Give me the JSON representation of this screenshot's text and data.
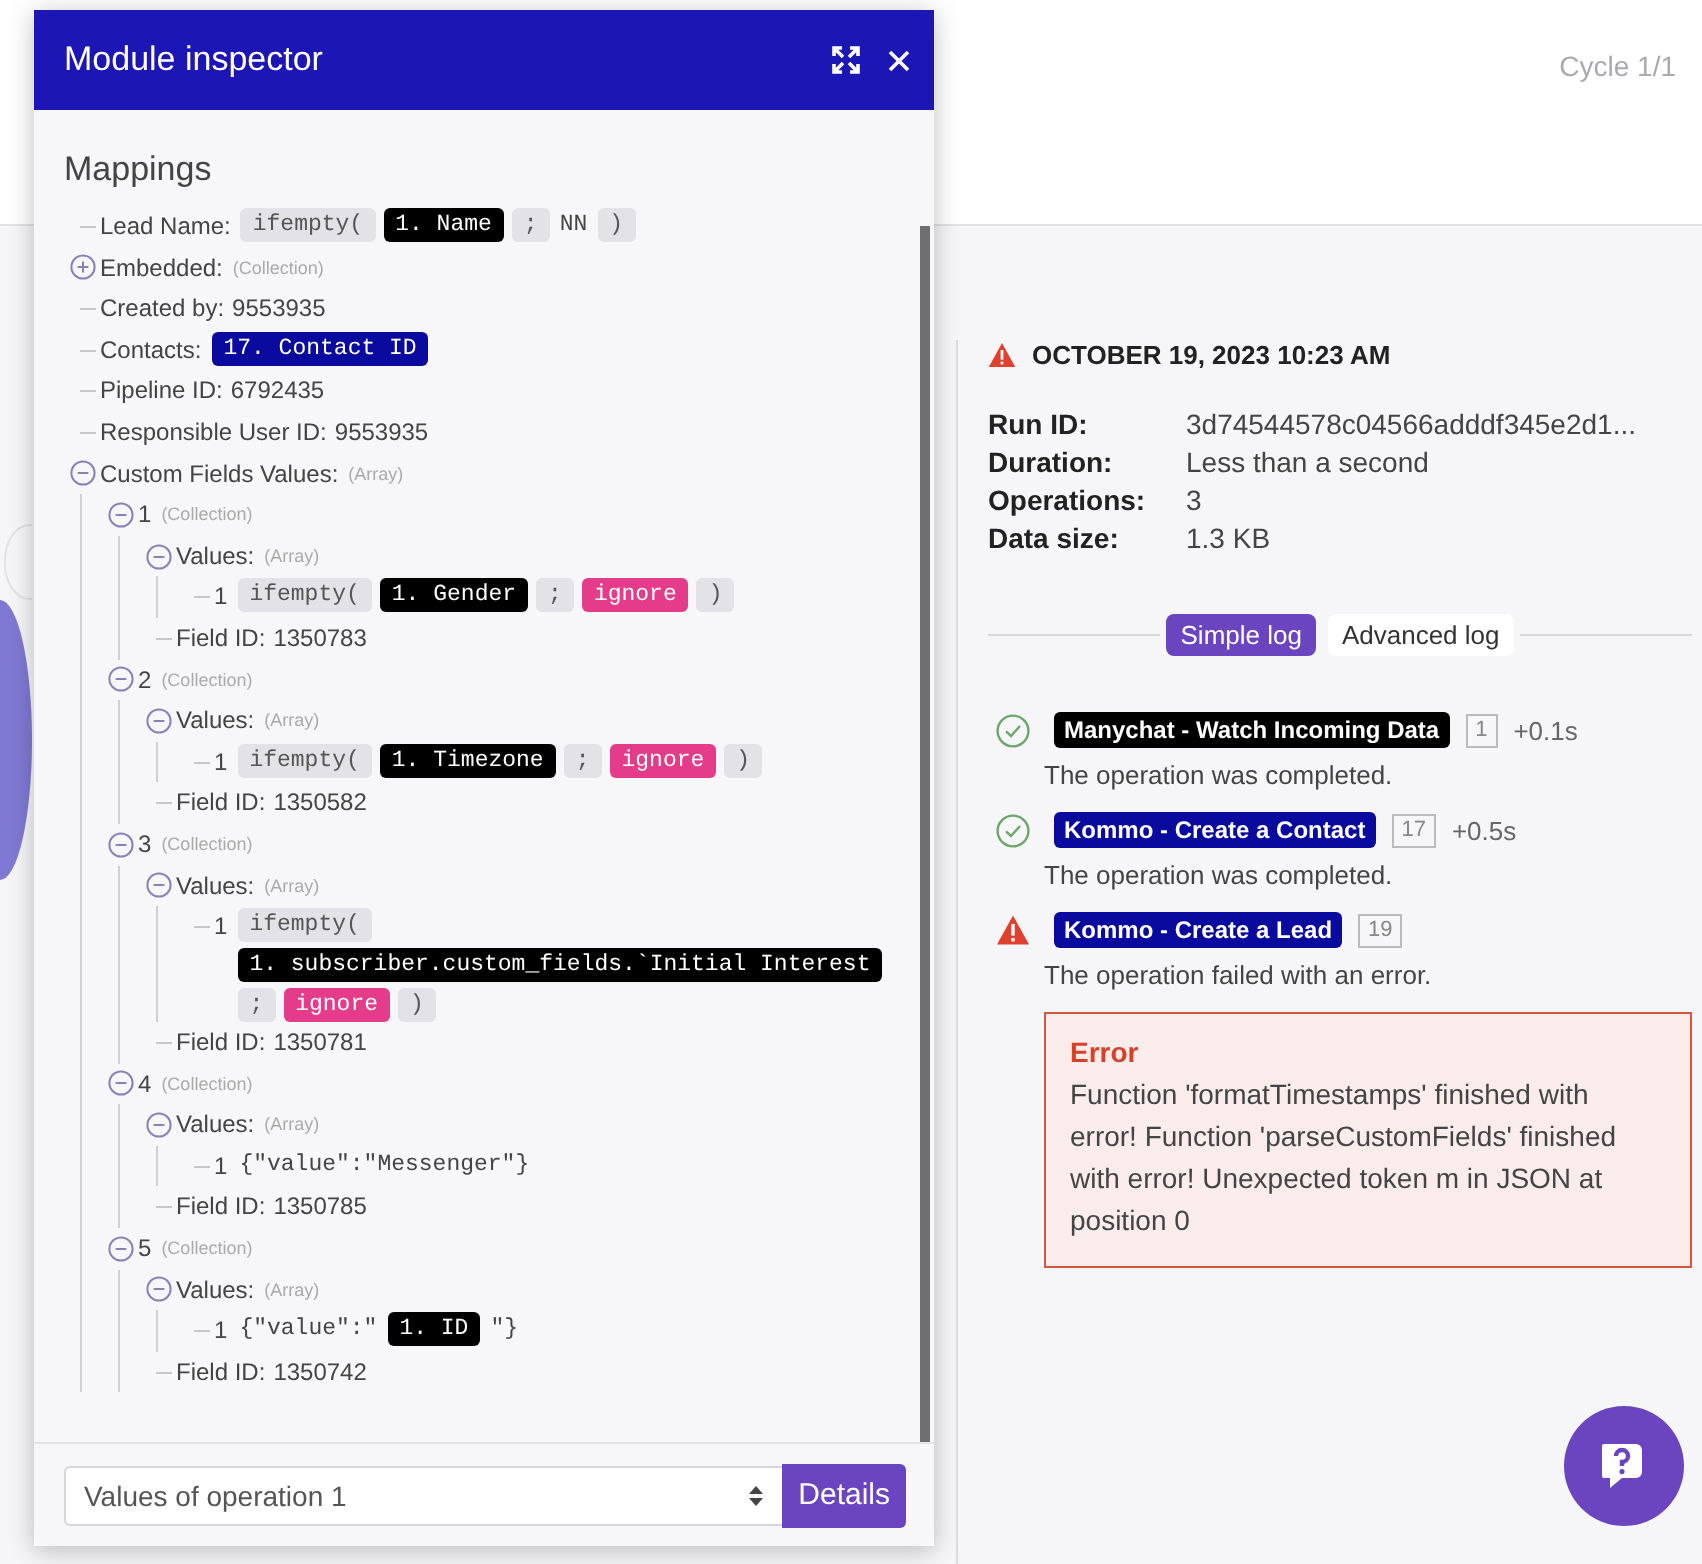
{
  "header": {
    "cycle": "Cycle 1/1"
  },
  "inspector": {
    "title": "Module inspector",
    "section_title": "Mappings",
    "mappings": [
      {
        "label": "Lead Name:",
        "tokens": [
          {
            "kind": "func",
            "text": "ifempty("
          },
          {
            "kind": "var",
            "text": "1. Name"
          },
          {
            "kind": "sep",
            "text": ";"
          },
          {
            "kind": "text",
            "text": "NN"
          },
          {
            "kind": "sep",
            "text": ")"
          }
        ]
      },
      {
        "label": "Embedded:",
        "type": "(Collection)",
        "expanded": false
      },
      {
        "label": "Created by:",
        "value": "9553935"
      },
      {
        "label": "Contacts:",
        "tokens": [
          {
            "kind": "ref",
            "text": "17. Contact ID"
          }
        ]
      },
      {
        "label": "Pipeline ID:",
        "value": "6792435"
      },
      {
        "label": "Responsible User ID:",
        "value": "9553935"
      },
      {
        "label": "Custom Fields Values:",
        "type": "(Array)",
        "expanded": true,
        "children": [
          {
            "label": "1",
            "type": "(Collection)",
            "expanded": true,
            "children": [
              {
                "label": "Values:",
                "type": "(Array)",
                "expanded": true,
                "children": [
                  {
                    "label": "1",
                    "tokens": [
                      {
                        "kind": "func",
                        "text": "ifempty("
                      },
                      {
                        "kind": "var",
                        "text": "1. Gender"
                      },
                      {
                        "kind": "sep",
                        "text": ";"
                      },
                      {
                        "kind": "keyword",
                        "text": "ignore"
                      },
                      {
                        "kind": "sep",
                        "text": ")"
                      }
                    ]
                  }
                ]
              },
              {
                "label": "Field ID:",
                "value": "1350783"
              }
            ]
          },
          {
            "label": "2",
            "type": "(Collection)",
            "expanded": true,
            "children": [
              {
                "label": "Values:",
                "type": "(Array)",
                "expanded": true,
                "children": [
                  {
                    "label": "1",
                    "tokens": [
                      {
                        "kind": "func",
                        "text": "ifempty("
                      },
                      {
                        "kind": "var",
                        "text": "1. Timezone"
                      },
                      {
                        "kind": "sep",
                        "text": ";"
                      },
                      {
                        "kind": "keyword",
                        "text": "ignore"
                      },
                      {
                        "kind": "sep",
                        "text": ")"
                      }
                    ]
                  }
                ]
              },
              {
                "label": "Field ID:",
                "value": "1350582"
              }
            ]
          },
          {
            "label": "3",
            "type": "(Collection)",
            "expanded": true,
            "children": [
              {
                "label": "Values:",
                "type": "(Array)",
                "expanded": true,
                "children": [
                  {
                    "label": "1",
                    "tokens": [
                      {
                        "kind": "func",
                        "text": "ifempty("
                      },
                      {
                        "kind": "var",
                        "text": "1. subscriber.custom_fields.`Initial Interest"
                      },
                      {
                        "kind": "sep",
                        "text": ";"
                      },
                      {
                        "kind": "keyword",
                        "text": "ignore"
                      },
                      {
                        "kind": "sep",
                        "text": ")"
                      }
                    ]
                  }
                ]
              },
              {
                "label": "Field ID:",
                "value": "1350781"
              }
            ]
          },
          {
            "label": "4",
            "type": "(Collection)",
            "expanded": true,
            "children": [
              {
                "label": "Values:",
                "type": "(Array)",
                "expanded": true,
                "children": [
                  {
                    "label": "1",
                    "tokens": [
                      {
                        "kind": "text",
                        "text": "{\"value\":\"Messenger\"}"
                      }
                    ]
                  }
                ]
              },
              {
                "label": "Field ID:",
                "value": "1350785"
              }
            ]
          },
          {
            "label": "5",
            "type": "(Collection)",
            "expanded": true,
            "children": [
              {
                "label": "Values:",
                "type": "(Array)",
                "expanded": true,
                "children": [
                  {
                    "label": "1",
                    "tokens": [
                      {
                        "kind": "text",
                        "text": "{\"value\":\""
                      },
                      {
                        "kind": "var",
                        "text": "1. ID"
                      },
                      {
                        "kind": "text",
                        "text": "\"}"
                      }
                    ]
                  }
                ]
              },
              {
                "label": "Field ID:",
                "value": "1350742"
              }
            ]
          }
        ]
      }
    ],
    "operation_select": {
      "value": "Values of operation 1"
    },
    "details_button": "Details"
  },
  "run": {
    "date": "OCTOBER 19, 2023 10:23 AM",
    "details": [
      {
        "label": "Run ID:",
        "value": "3d74544578c04566adddf345e2d1..."
      },
      {
        "label": "Duration:",
        "value": "Less than a second"
      },
      {
        "label": "Operations:",
        "value": "3"
      },
      {
        "label": "Data size:",
        "value": "1.3 KB"
      }
    ],
    "tabs": [
      {
        "label": "Simple log",
        "selected": true
      },
      {
        "label": "Advanced log",
        "selected": false
      }
    ],
    "log": [
      {
        "kind": "success",
        "module": "Manychat - Watch Incoming Data",
        "color": "#000000",
        "id": "1",
        "time": "+0.1s",
        "message": "The operation was completed."
      },
      {
        "kind": "success",
        "module": "Kommo - Create a Contact",
        "color": "#0a0a9e",
        "id": "17",
        "time": "+0.5s",
        "message": "The operation was completed."
      },
      {
        "kind": "error",
        "module": "Kommo - Create a Lead",
        "color": "#0a0a9e",
        "id": "19",
        "message": "The operation failed with an error."
      }
    ],
    "error": {
      "title": "Error",
      "text": "Function 'formatTimestamps' finished with error! Function 'parseCustomFields' finished with error! Unexpected token m in JSON at position 0"
    }
  }
}
